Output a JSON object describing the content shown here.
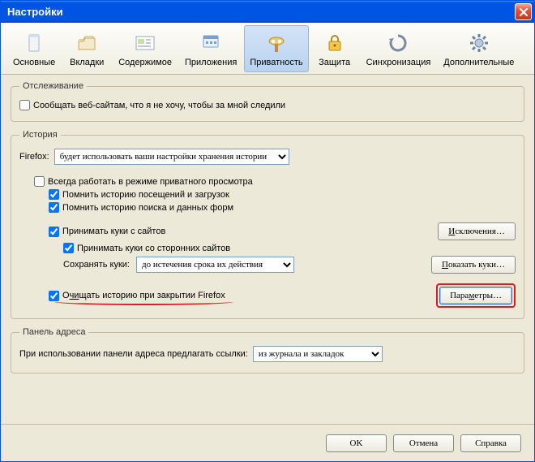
{
  "title": "Настройки",
  "toolbar": {
    "items": [
      {
        "key": "general",
        "label": "Основные"
      },
      {
        "key": "tabs",
        "label": "Вкладки"
      },
      {
        "key": "content",
        "label": "Содержимое"
      },
      {
        "key": "applications",
        "label": "Приложения"
      },
      {
        "key": "privacy",
        "label": "Приватность"
      },
      {
        "key": "security",
        "label": "Защита"
      },
      {
        "key": "sync",
        "label": "Синхронизация"
      },
      {
        "key": "advanced",
        "label": "Дополнительные"
      }
    ],
    "selected": "privacy"
  },
  "tracking": {
    "legend": "Отслеживание",
    "dnt_label": "Сообщать веб-сайтам, что я не хочу, чтобы за мной следили",
    "dnt_checked": false
  },
  "history": {
    "legend": "История",
    "firefox_label": "Firefox:",
    "firefox_mode": "будет использовать ваши настройки хранения истории",
    "always_private": {
      "label": "Всегда работать в режиме приватного просмотра",
      "checked": false
    },
    "remember_browse": {
      "label": "Помнить историю посещений и загрузок",
      "checked": true
    },
    "remember_search": {
      "label": "Помнить историю поиска и данных форм",
      "checked": true
    },
    "accept_cookies": {
      "label": "Принимать куки с сайтов",
      "checked": true
    },
    "exceptions_btn": "Исключения…",
    "third_party": {
      "label": "Принимать куки со сторонних сайтов",
      "checked": true
    },
    "keep_label": "Сохранять куки:",
    "keep_value": "до истечения срока их действия",
    "show_cookies_btn": "Показать куки…",
    "clear_on_close": {
      "label": "Очищать историю при закрытии Firefox",
      "checked": true
    },
    "settings_btn": "Параметры…"
  },
  "addressbar": {
    "legend": "Панель адреса",
    "suggest_label": "При использовании панели адреса предлагать ссылки:",
    "suggest_value": "из журнала и закладок"
  },
  "footer": {
    "ok": "OK",
    "cancel": "Отмена",
    "help": "Справка"
  },
  "accessor": {
    "hi": "и",
    "sklucheniya": "И",
    "ok": "П",
    "chi": "чи",
    "ara": "П",
    "e": "е"
  }
}
